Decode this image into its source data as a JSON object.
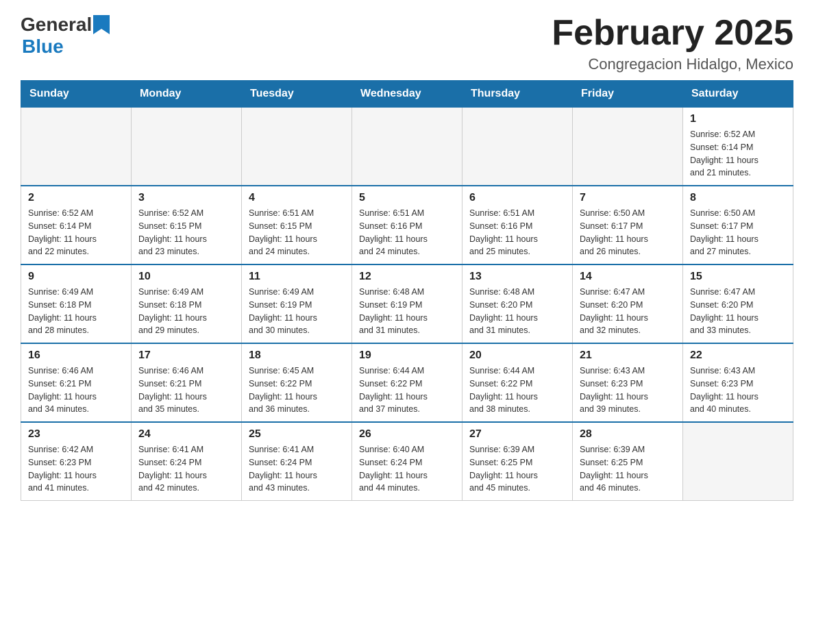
{
  "logo": {
    "general": "General",
    "blue": "Blue"
  },
  "title": "February 2025",
  "location": "Congregacion Hidalgo, Mexico",
  "days_of_week": [
    "Sunday",
    "Monday",
    "Tuesday",
    "Wednesday",
    "Thursday",
    "Friday",
    "Saturday"
  ],
  "weeks": [
    {
      "days": [
        {
          "number": "",
          "info": ""
        },
        {
          "number": "",
          "info": ""
        },
        {
          "number": "",
          "info": ""
        },
        {
          "number": "",
          "info": ""
        },
        {
          "number": "",
          "info": ""
        },
        {
          "number": "",
          "info": ""
        },
        {
          "number": "1",
          "info": "Sunrise: 6:52 AM\nSunset: 6:14 PM\nDaylight: 11 hours\nand 21 minutes."
        }
      ]
    },
    {
      "days": [
        {
          "number": "2",
          "info": "Sunrise: 6:52 AM\nSunset: 6:14 PM\nDaylight: 11 hours\nand 22 minutes."
        },
        {
          "number": "3",
          "info": "Sunrise: 6:52 AM\nSunset: 6:15 PM\nDaylight: 11 hours\nand 23 minutes."
        },
        {
          "number": "4",
          "info": "Sunrise: 6:51 AM\nSunset: 6:15 PM\nDaylight: 11 hours\nand 24 minutes."
        },
        {
          "number": "5",
          "info": "Sunrise: 6:51 AM\nSunset: 6:16 PM\nDaylight: 11 hours\nand 24 minutes."
        },
        {
          "number": "6",
          "info": "Sunrise: 6:51 AM\nSunset: 6:16 PM\nDaylight: 11 hours\nand 25 minutes."
        },
        {
          "number": "7",
          "info": "Sunrise: 6:50 AM\nSunset: 6:17 PM\nDaylight: 11 hours\nand 26 minutes."
        },
        {
          "number": "8",
          "info": "Sunrise: 6:50 AM\nSunset: 6:17 PM\nDaylight: 11 hours\nand 27 minutes."
        }
      ]
    },
    {
      "days": [
        {
          "number": "9",
          "info": "Sunrise: 6:49 AM\nSunset: 6:18 PM\nDaylight: 11 hours\nand 28 minutes."
        },
        {
          "number": "10",
          "info": "Sunrise: 6:49 AM\nSunset: 6:18 PM\nDaylight: 11 hours\nand 29 minutes."
        },
        {
          "number": "11",
          "info": "Sunrise: 6:49 AM\nSunset: 6:19 PM\nDaylight: 11 hours\nand 30 minutes."
        },
        {
          "number": "12",
          "info": "Sunrise: 6:48 AM\nSunset: 6:19 PM\nDaylight: 11 hours\nand 31 minutes."
        },
        {
          "number": "13",
          "info": "Sunrise: 6:48 AM\nSunset: 6:20 PM\nDaylight: 11 hours\nand 31 minutes."
        },
        {
          "number": "14",
          "info": "Sunrise: 6:47 AM\nSunset: 6:20 PM\nDaylight: 11 hours\nand 32 minutes."
        },
        {
          "number": "15",
          "info": "Sunrise: 6:47 AM\nSunset: 6:20 PM\nDaylight: 11 hours\nand 33 minutes."
        }
      ]
    },
    {
      "days": [
        {
          "number": "16",
          "info": "Sunrise: 6:46 AM\nSunset: 6:21 PM\nDaylight: 11 hours\nand 34 minutes."
        },
        {
          "number": "17",
          "info": "Sunrise: 6:46 AM\nSunset: 6:21 PM\nDaylight: 11 hours\nand 35 minutes."
        },
        {
          "number": "18",
          "info": "Sunrise: 6:45 AM\nSunset: 6:22 PM\nDaylight: 11 hours\nand 36 minutes."
        },
        {
          "number": "19",
          "info": "Sunrise: 6:44 AM\nSunset: 6:22 PM\nDaylight: 11 hours\nand 37 minutes."
        },
        {
          "number": "20",
          "info": "Sunrise: 6:44 AM\nSunset: 6:22 PM\nDaylight: 11 hours\nand 38 minutes."
        },
        {
          "number": "21",
          "info": "Sunrise: 6:43 AM\nSunset: 6:23 PM\nDaylight: 11 hours\nand 39 minutes."
        },
        {
          "number": "22",
          "info": "Sunrise: 6:43 AM\nSunset: 6:23 PM\nDaylight: 11 hours\nand 40 minutes."
        }
      ]
    },
    {
      "days": [
        {
          "number": "23",
          "info": "Sunrise: 6:42 AM\nSunset: 6:23 PM\nDaylight: 11 hours\nand 41 minutes."
        },
        {
          "number": "24",
          "info": "Sunrise: 6:41 AM\nSunset: 6:24 PM\nDaylight: 11 hours\nand 42 minutes."
        },
        {
          "number": "25",
          "info": "Sunrise: 6:41 AM\nSunset: 6:24 PM\nDaylight: 11 hours\nand 43 minutes."
        },
        {
          "number": "26",
          "info": "Sunrise: 6:40 AM\nSunset: 6:24 PM\nDaylight: 11 hours\nand 44 minutes."
        },
        {
          "number": "27",
          "info": "Sunrise: 6:39 AM\nSunset: 6:25 PM\nDaylight: 11 hours\nand 45 minutes."
        },
        {
          "number": "28",
          "info": "Sunrise: 6:39 AM\nSunset: 6:25 PM\nDaylight: 11 hours\nand 46 minutes."
        },
        {
          "number": "",
          "info": ""
        }
      ]
    }
  ]
}
